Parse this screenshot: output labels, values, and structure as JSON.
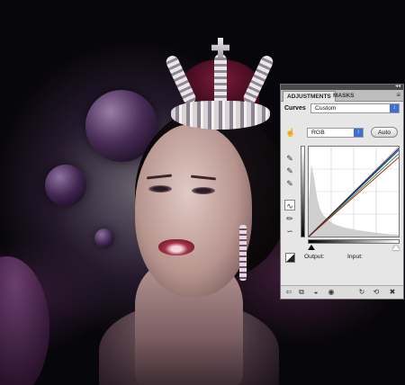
{
  "panel": {
    "tabs": [
      {
        "label": "ADJUSTMENTS"
      },
      {
        "label": "MASKS"
      }
    ],
    "title_label": "Curves",
    "preset_value": "Custom",
    "channel_value": "RGB",
    "auto_label": "Auto",
    "output_label": "Output:",
    "input_label": "Input:",
    "icons": {
      "collapse": "double-arrow-icon",
      "menu": "panel-menu-icon",
      "hand": "on-image-adjust-icon",
      "eyedropper_black": "eyedropper-black-icon",
      "eyedropper_gray": "eyedropper-gray-icon",
      "eyedropper_white": "eyedropper-white-icon",
      "curve_tool": "curve-edit-icon",
      "pencil_tool": "pencil-icon",
      "smooth_tool": "smooth-icon",
      "clipping": "clipping-icon"
    },
    "curves": {
      "accent_red": "#c21f1f",
      "accent_green": "#1f9b33",
      "accent_blue": "#2136c8"
    }
  }
}
